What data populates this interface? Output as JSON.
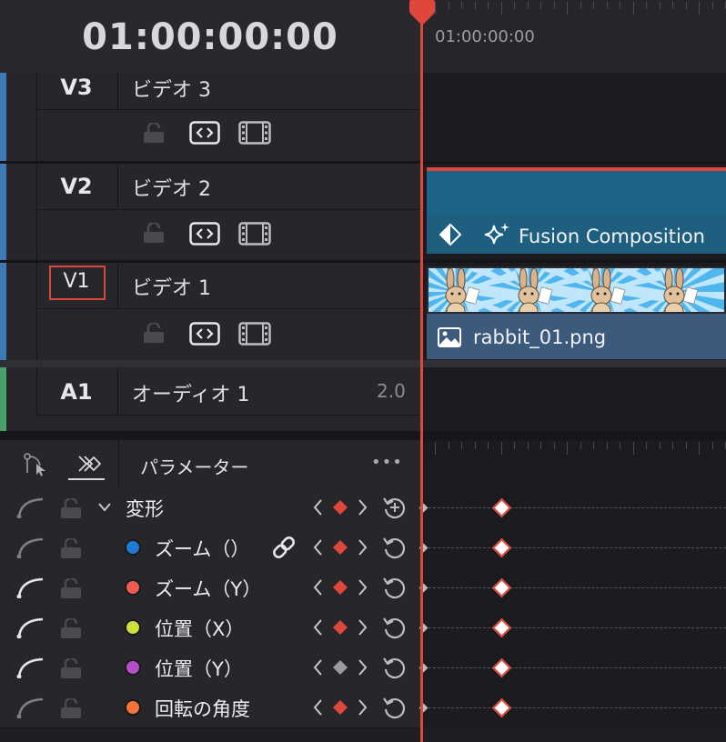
{
  "timecode": "01:00:00:00",
  "ruler_timecode": "01:00:00:00",
  "tracks": [
    {
      "id": "V3",
      "name": "ビデオ 3"
    },
    {
      "id": "V2",
      "name": "ビデオ 2"
    },
    {
      "id": "V1",
      "name": "ビデオ 1"
    },
    {
      "id": "A1",
      "name": "オーディオ 1",
      "channels": "2.0"
    }
  ],
  "clips": {
    "fusion": "Fusion Composition",
    "image": "rabbit_01.png"
  },
  "parameters_panel": {
    "title": "パラメーター",
    "more": "•••",
    "rows": [
      {
        "label": "変形"
      },
      {
        "label": "ズーム（）",
        "color": "#1f7bd6"
      },
      {
        "label": "ズーム（Y）",
        "color": "#ef5a52"
      },
      {
        "label": "位置（X）",
        "color": "#cfe03c"
      },
      {
        "label": "位置（Y）",
        "color": "#b24ec7"
      },
      {
        "label": "回転の角度",
        "color": "#f4743c"
      }
    ]
  },
  "colors": {
    "playhead": "#e0473c",
    "video_track_stripe": "#3f79b5",
    "audio_track_stripe": "#4aa06a",
    "fusion_clip": "#1c6487",
    "image_clip": "#3c5a7c"
  },
  "icons": {
    "lock": "lock-icon",
    "code": "code-icon",
    "film": "film-strip-icon",
    "link": "link-icon",
    "reset": "reset-icon",
    "curve": "curve-icon",
    "keyframe": "keyframe-icon"
  }
}
